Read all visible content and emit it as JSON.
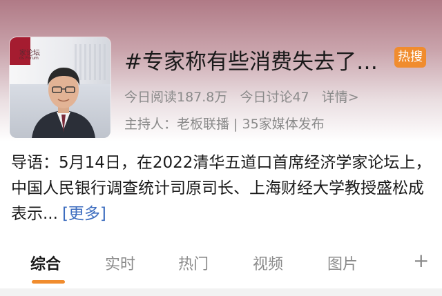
{
  "topic": {
    "thumbnail": {
      "banner_text": "家论坛",
      "banner_subtext": "ds Forum"
    },
    "title": "#专家称有些消费失去了…",
    "hot_badge": "热搜",
    "reads": "今日阅读187.8万",
    "discussions": "今日讨论47",
    "details_link": "详情>",
    "host": "主持人：老板联播 | 35家媒体发布"
  },
  "intro": {
    "text": "导语：5月14日，在2022清华五道口首席经济学家论坛上，中国人民银行调查统计司原司长、上海财经大学教授盛松成表示...",
    "more_link": "[更多]"
  },
  "tabs": [
    {
      "label": "综合",
      "active": true
    },
    {
      "label": "实时",
      "active": false
    },
    {
      "label": "热门",
      "active": false
    },
    {
      "label": "视频",
      "active": false
    },
    {
      "label": "图片",
      "active": false
    }
  ],
  "add_tab_icon": "plus-icon",
  "colors": {
    "accent": "#f08c2e",
    "link": "#3d6dbf"
  }
}
